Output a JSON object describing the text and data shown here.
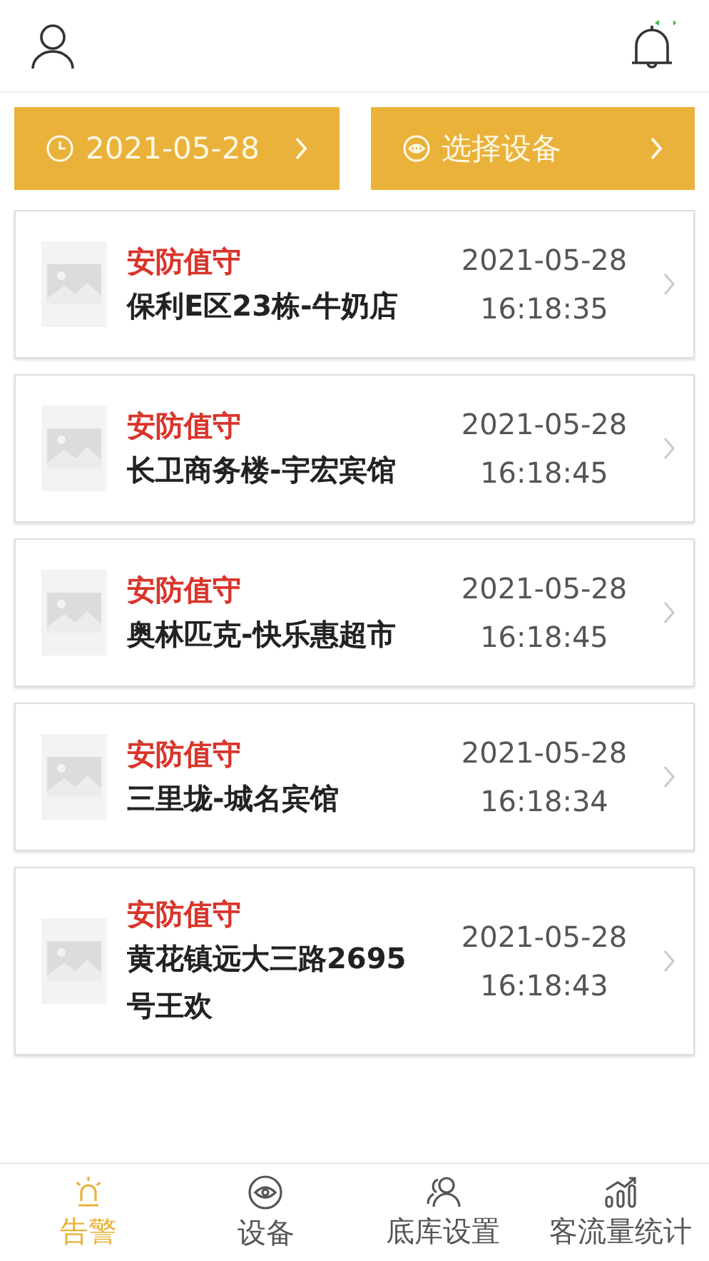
{
  "filters": [
    {
      "kind": "date",
      "label": "2021-05-28"
    },
    {
      "kind": "device",
      "label": "选择设备"
    }
  ],
  "alarms": [
    {
      "type": "安防值守",
      "name": "保利E区23栋-牛奶店",
      "date": "2021-05-28",
      "time": "16:18:35"
    },
    {
      "type": "安防值守",
      "name": "长卫商务楼-宇宏宾馆",
      "date": "2021-05-28",
      "time": "16:18:45"
    },
    {
      "type": "安防值守",
      "name": "奥林匹克-快乐惠超市",
      "date": "2021-05-28",
      "time": "16:18:45"
    },
    {
      "type": "安防值守",
      "name": "三里垅-城名宾馆",
      "date": "2021-05-28",
      "time": "16:18:34"
    },
    {
      "type": "安防值守",
      "name": "黄花镇远大三路2695号王欢",
      "date": "2021-05-28",
      "time": "16:18:43"
    }
  ],
  "tabs": [
    {
      "kind": "alarm",
      "label": "告警",
      "selected": true
    },
    {
      "kind": "device",
      "label": "设备",
      "selected": false
    },
    {
      "kind": "library",
      "label": "底库设置",
      "selected": false
    },
    {
      "kind": "stats",
      "label": "客流量统计",
      "selected": false
    }
  ]
}
